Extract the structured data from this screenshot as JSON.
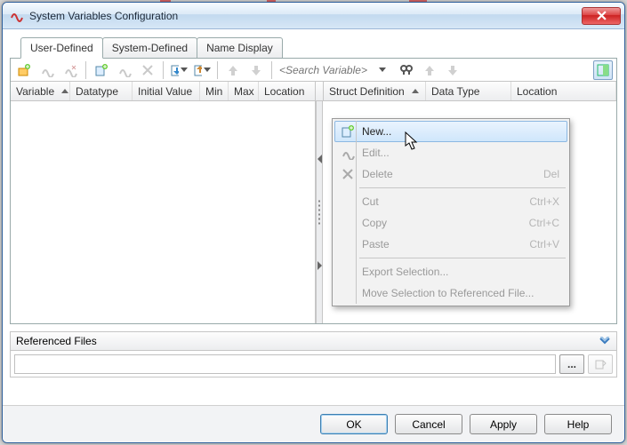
{
  "window": {
    "title": "System Variables Configuration"
  },
  "tabs": [
    {
      "label": "User-Defined",
      "active": true
    },
    {
      "label": "System-Defined",
      "active": false
    },
    {
      "label": "Name Display",
      "active": false
    }
  ],
  "toolbar": {
    "search_placeholder": "<Search Variable>"
  },
  "left_columns": [
    {
      "label": "Variable",
      "sort": "asc"
    },
    {
      "label": "Datatype"
    },
    {
      "label": "Initial Value"
    },
    {
      "label": "Min"
    },
    {
      "label": "Max"
    },
    {
      "label": "Location"
    }
  ],
  "right_columns": [
    {
      "label": "Struct Definition",
      "sort": "asc"
    },
    {
      "label": "Data Type"
    },
    {
      "label": "Location"
    }
  ],
  "referenced_files": {
    "title": "Referenced Files",
    "browse_label": "..."
  },
  "footer": {
    "ok": "OK",
    "cancel": "Cancel",
    "apply": "Apply",
    "help": "Help"
  },
  "context_menu": {
    "items": [
      {
        "kind": "item",
        "label": "New...",
        "icon": "new-var-icon",
        "state": "hover"
      },
      {
        "kind": "item",
        "label": "Edit...",
        "icon": "edit-var-icon",
        "state": "disabled"
      },
      {
        "kind": "item",
        "label": "Delete",
        "icon": "delete-icon",
        "state": "disabled",
        "accel": "Del"
      },
      {
        "kind": "sep"
      },
      {
        "kind": "item",
        "label": "Cut",
        "state": "disabled",
        "accel": "Ctrl+X"
      },
      {
        "kind": "item",
        "label": "Copy",
        "state": "disabled",
        "accel": "Ctrl+C"
      },
      {
        "kind": "item",
        "label": "Paste",
        "state": "disabled",
        "accel": "Ctrl+V"
      },
      {
        "kind": "sep"
      },
      {
        "kind": "item",
        "label": "Export Selection...",
        "state": "disabled"
      },
      {
        "kind": "item",
        "label": "Move Selection to Referenced File...",
        "state": "disabled"
      }
    ]
  }
}
